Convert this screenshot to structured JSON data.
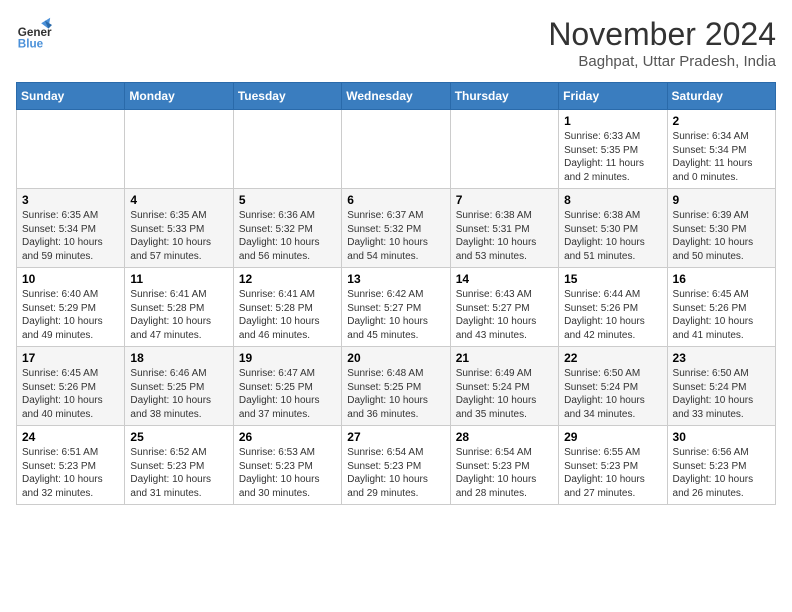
{
  "logo": {
    "line1": "General",
    "line2": "Blue"
  },
  "title": "November 2024",
  "subtitle": "Baghpat, Uttar Pradesh, India",
  "days_of_week": [
    "Sunday",
    "Monday",
    "Tuesday",
    "Wednesday",
    "Thursday",
    "Friday",
    "Saturday"
  ],
  "weeks": [
    [
      {
        "day": "",
        "info": ""
      },
      {
        "day": "",
        "info": ""
      },
      {
        "day": "",
        "info": ""
      },
      {
        "day": "",
        "info": ""
      },
      {
        "day": "",
        "info": ""
      },
      {
        "day": "1",
        "info": "Sunrise: 6:33 AM\nSunset: 5:35 PM\nDaylight: 11 hours and 2 minutes."
      },
      {
        "day": "2",
        "info": "Sunrise: 6:34 AM\nSunset: 5:34 PM\nDaylight: 11 hours and 0 minutes."
      }
    ],
    [
      {
        "day": "3",
        "info": "Sunrise: 6:35 AM\nSunset: 5:34 PM\nDaylight: 10 hours and 59 minutes."
      },
      {
        "day": "4",
        "info": "Sunrise: 6:35 AM\nSunset: 5:33 PM\nDaylight: 10 hours and 57 minutes."
      },
      {
        "day": "5",
        "info": "Sunrise: 6:36 AM\nSunset: 5:32 PM\nDaylight: 10 hours and 56 minutes."
      },
      {
        "day": "6",
        "info": "Sunrise: 6:37 AM\nSunset: 5:32 PM\nDaylight: 10 hours and 54 minutes."
      },
      {
        "day": "7",
        "info": "Sunrise: 6:38 AM\nSunset: 5:31 PM\nDaylight: 10 hours and 53 minutes."
      },
      {
        "day": "8",
        "info": "Sunrise: 6:38 AM\nSunset: 5:30 PM\nDaylight: 10 hours and 51 minutes."
      },
      {
        "day": "9",
        "info": "Sunrise: 6:39 AM\nSunset: 5:30 PM\nDaylight: 10 hours and 50 minutes."
      }
    ],
    [
      {
        "day": "10",
        "info": "Sunrise: 6:40 AM\nSunset: 5:29 PM\nDaylight: 10 hours and 49 minutes."
      },
      {
        "day": "11",
        "info": "Sunrise: 6:41 AM\nSunset: 5:28 PM\nDaylight: 10 hours and 47 minutes."
      },
      {
        "day": "12",
        "info": "Sunrise: 6:41 AM\nSunset: 5:28 PM\nDaylight: 10 hours and 46 minutes."
      },
      {
        "day": "13",
        "info": "Sunrise: 6:42 AM\nSunset: 5:27 PM\nDaylight: 10 hours and 45 minutes."
      },
      {
        "day": "14",
        "info": "Sunrise: 6:43 AM\nSunset: 5:27 PM\nDaylight: 10 hours and 43 minutes."
      },
      {
        "day": "15",
        "info": "Sunrise: 6:44 AM\nSunset: 5:26 PM\nDaylight: 10 hours and 42 minutes."
      },
      {
        "day": "16",
        "info": "Sunrise: 6:45 AM\nSunset: 5:26 PM\nDaylight: 10 hours and 41 minutes."
      }
    ],
    [
      {
        "day": "17",
        "info": "Sunrise: 6:45 AM\nSunset: 5:26 PM\nDaylight: 10 hours and 40 minutes."
      },
      {
        "day": "18",
        "info": "Sunrise: 6:46 AM\nSunset: 5:25 PM\nDaylight: 10 hours and 38 minutes."
      },
      {
        "day": "19",
        "info": "Sunrise: 6:47 AM\nSunset: 5:25 PM\nDaylight: 10 hours and 37 minutes."
      },
      {
        "day": "20",
        "info": "Sunrise: 6:48 AM\nSunset: 5:25 PM\nDaylight: 10 hours and 36 minutes."
      },
      {
        "day": "21",
        "info": "Sunrise: 6:49 AM\nSunset: 5:24 PM\nDaylight: 10 hours and 35 minutes."
      },
      {
        "day": "22",
        "info": "Sunrise: 6:50 AM\nSunset: 5:24 PM\nDaylight: 10 hours and 34 minutes."
      },
      {
        "day": "23",
        "info": "Sunrise: 6:50 AM\nSunset: 5:24 PM\nDaylight: 10 hours and 33 minutes."
      }
    ],
    [
      {
        "day": "24",
        "info": "Sunrise: 6:51 AM\nSunset: 5:23 PM\nDaylight: 10 hours and 32 minutes."
      },
      {
        "day": "25",
        "info": "Sunrise: 6:52 AM\nSunset: 5:23 PM\nDaylight: 10 hours and 31 minutes."
      },
      {
        "day": "26",
        "info": "Sunrise: 6:53 AM\nSunset: 5:23 PM\nDaylight: 10 hours and 30 minutes."
      },
      {
        "day": "27",
        "info": "Sunrise: 6:54 AM\nSunset: 5:23 PM\nDaylight: 10 hours and 29 minutes."
      },
      {
        "day": "28",
        "info": "Sunrise: 6:54 AM\nSunset: 5:23 PM\nDaylight: 10 hours and 28 minutes."
      },
      {
        "day": "29",
        "info": "Sunrise: 6:55 AM\nSunset: 5:23 PM\nDaylight: 10 hours and 27 minutes."
      },
      {
        "day": "30",
        "info": "Sunrise: 6:56 AM\nSunset: 5:23 PM\nDaylight: 10 hours and 26 minutes."
      }
    ]
  ]
}
